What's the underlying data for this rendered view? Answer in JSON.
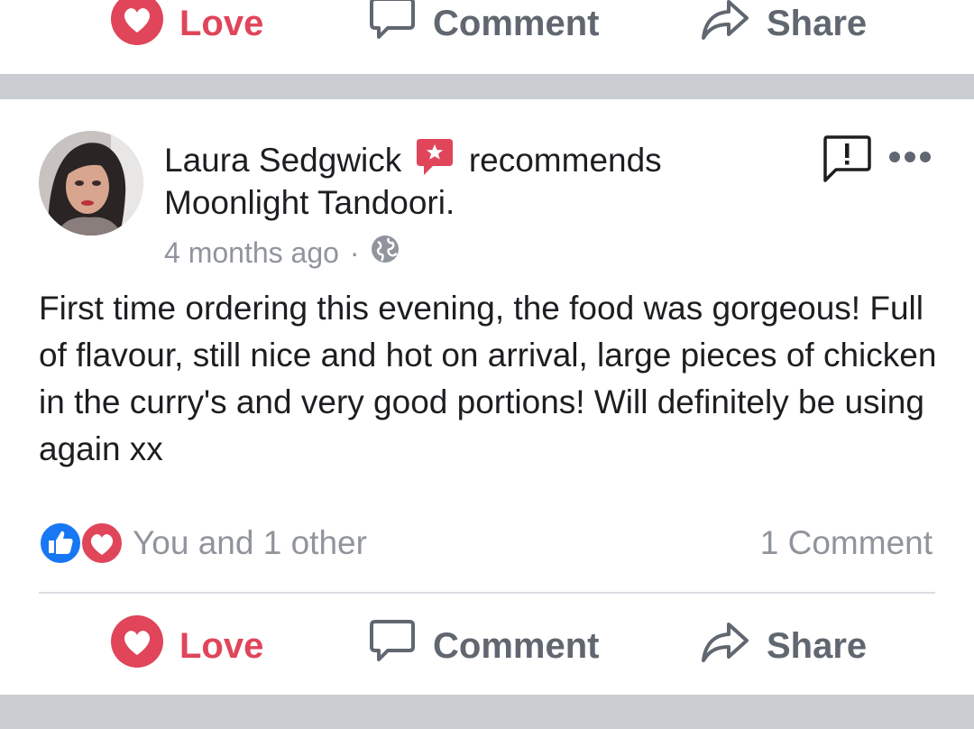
{
  "actions": {
    "love": "Love",
    "comment": "Comment",
    "share": "Share"
  },
  "post": {
    "author": "Laura Sedgwick",
    "verb": "recommends",
    "page_name": "Moonlight Tandoori.",
    "timestamp": "4 months ago",
    "separator_dot": "·",
    "privacy_icon": "globe-icon",
    "body": "First time ordering this evening, the food was gorgeous! Full of flavour, still nice and hot on arrival, large pieces of chicken in the curry's and very good portions! Will definitely be using again xx",
    "reactions_text": "You and 1 other",
    "comment_count": "1 Comment"
  },
  "colors": {
    "love": "#e0455a",
    "like": "#1877f2",
    "recommend": "#e0455a",
    "muted": "#90949c",
    "separator": "#c9ccd1"
  }
}
